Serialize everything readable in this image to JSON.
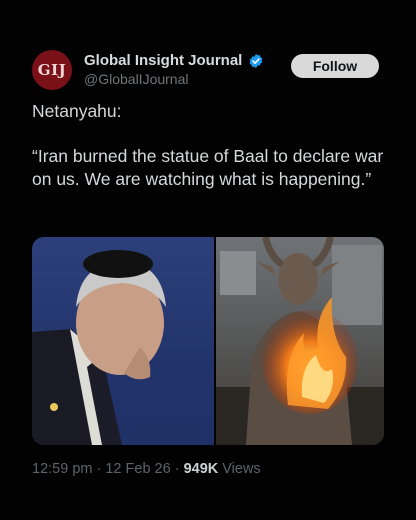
{
  "account": {
    "avatar_text": "GIJ",
    "name": "Global Insight Journal",
    "handle": "@GlobalIJournal",
    "verified_icon": "verified-badge-icon",
    "verified_color": "#1d9bf0"
  },
  "follow_button": {
    "label": "Follow"
  },
  "tweet": {
    "line1": "Netanyahu:",
    "line2": "“Iran burned the statue of Baal to declare war on us. We are watching what is happening.”"
  },
  "media": {
    "left_image": "photo-of-man-with-kippah",
    "right_image": "photo-of-burning-bull-headed-statue"
  },
  "meta": {
    "time": "12:59 pm",
    "separator1": " · ",
    "date": "12 Feb 26",
    "separator2": " · ",
    "views_count": "949K",
    "views_label": " Views"
  }
}
